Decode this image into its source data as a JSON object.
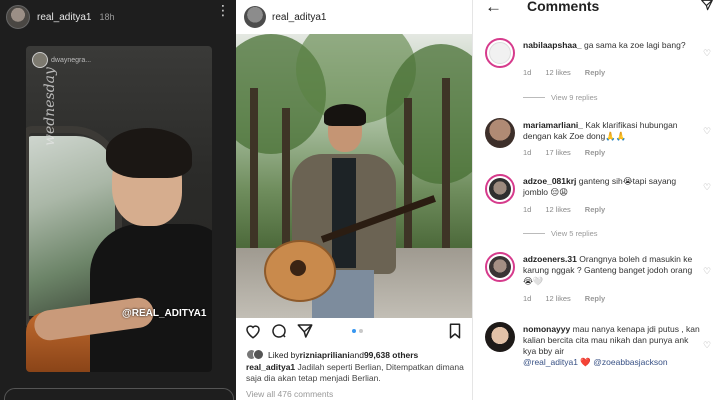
{
  "story": {
    "username": "real_aditya1",
    "time": "18h",
    "top_mention": "dwaynegra...",
    "script_text": "wednesday",
    "tag": "@REAL_ADITYA1"
  },
  "post": {
    "username": "real_aditya1",
    "likes_prefix": "Liked by ",
    "likes_user": "rizniapriliani",
    "likes_suffix": " and ",
    "likes_count": "99,638 others",
    "caption_user": "real_aditya1",
    "caption": "Jadilah seperti Berlian, Ditempatkan dimana saja dia akan tetap menjadi Berlian.",
    "view_all": "View all 476 comments",
    "carousel": {
      "count": 2,
      "active": 1
    }
  },
  "comments": {
    "title": "Comments",
    "items": [
      {
        "user": "nabilaapshaa_",
        "text": "ga sama ka zoe lagi bang?",
        "age": "1d",
        "likes": "12 likes",
        "reply": "Reply",
        "view_replies": "View 9 replies"
      },
      {
        "user": "mariamarliani_",
        "text": "Kak klarifikasi hubungan dengan kak Zoe dong🙏🙏",
        "age": "1d",
        "likes": "17 likes",
        "reply": "Reply"
      },
      {
        "user": "adzoe_081krj",
        "text": "ganteng sih😭tapi sayang jomblo 😔😩",
        "age": "1d",
        "likes": "12 likes",
        "reply": "Reply",
        "view_replies": "View 5 replies"
      },
      {
        "user": "adzoeners.31",
        "text": "Orangnya boleh d masukin ke karung nggak ? Ganteng banget jodoh orang 😭🤍",
        "age": "1d",
        "likes": "12 likes",
        "reply": "Reply"
      },
      {
        "user": "nomonayyy",
        "text": "mau nanya kenapa jdi putus , kan kalian bercita cita mau nikah dan punya ank kya bby air",
        "mention1": "@real_aditya1",
        "heart": "❤️",
        "mention2": "@zoeabbasjackson"
      }
    ]
  },
  "colors": {
    "accent_blue": "#3897f0",
    "story_ring": "#d63b8c",
    "mention": "#385185"
  }
}
